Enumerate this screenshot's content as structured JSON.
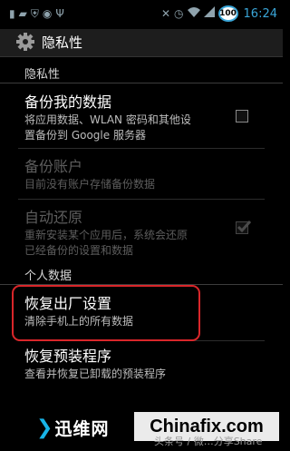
{
  "status_bar": {
    "icons_left": [
      "sim-icon",
      "sd-card-icon",
      "shield-icon",
      "gamepad-icon",
      "usb-icon"
    ],
    "icons_right": [
      "mute-icon",
      "alarm-icon",
      "wifi-icon",
      "signal-icon"
    ],
    "battery_level": "100",
    "time": "16:24",
    "accent_color": "#3aa6d8"
  },
  "action_bar": {
    "title": "隐私性"
  },
  "sections": {
    "privacy_header": "隐私性",
    "personal_data_header": "个人数据"
  },
  "items": {
    "backup_data": {
      "title": "备份我的数据",
      "summary_line1": "将应用数据、WLAN 密码和其他设",
      "summary_line2": "置备份到 Google 服务器",
      "checked": false
    },
    "backup_account": {
      "title": "备份账户",
      "summary": "目前没有账户存储备份数据"
    },
    "auto_restore": {
      "title": "自动还原",
      "summary_line1": "重新安装某个应用后，系统会还原",
      "summary_line2": "已经备份的设置和数据",
      "checked": true
    },
    "factory_reset": {
      "title": "恢复出厂设置",
      "summary": "清除手机上的所有数据"
    },
    "restore_preinstalled": {
      "title": "恢复预装程序",
      "summary": "查看并恢复已卸载的预装程序"
    }
  },
  "watermark": {
    "left_text": "迅维网",
    "right_text": "Chinafix.com",
    "small_text": "头条号 / 微…分享Share",
    "highlight_color": "#d9262a"
  }
}
